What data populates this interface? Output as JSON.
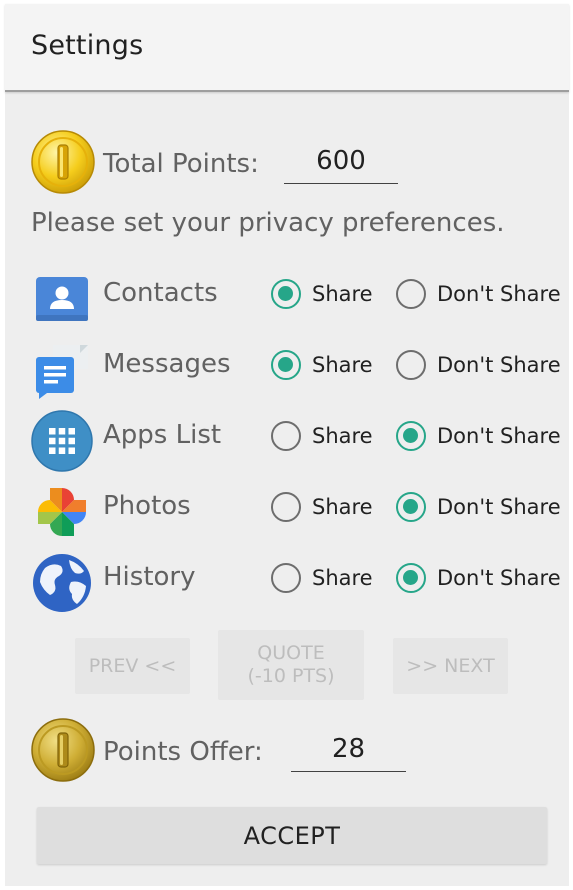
{
  "appbar": {
    "title": "Settings"
  },
  "total_points": {
    "label": "Total Points:",
    "value": "600"
  },
  "prompt": "Please set your privacy preferences.",
  "preferences": [
    {
      "label": "Contacts",
      "icon": "contacts-icon",
      "share_label": "Share",
      "dont_share_label": "Don't Share",
      "selected": "share"
    },
    {
      "label": "Messages",
      "icon": "messages-icon",
      "share_label": "Share",
      "dont_share_label": "Don't Share",
      "selected": "share"
    },
    {
      "label": "Apps List",
      "icon": "apps-list-icon",
      "share_label": "Share",
      "dont_share_label": "Don't Share",
      "selected": "dont_share"
    },
    {
      "label": "Photos",
      "icon": "photos-icon",
      "share_label": "Share",
      "dont_share_label": "Don't Share",
      "selected": "dont_share"
    },
    {
      "label": "History",
      "icon": "history-icon",
      "share_label": "Share",
      "dont_share_label": "Don't Share",
      "selected": "dont_share"
    }
  ],
  "nav": {
    "prev_label": "PREV <<",
    "quote_line1": "QUOTE",
    "quote_line2": "(-10 PTS)",
    "next_label": ">> NEXT"
  },
  "points_offer": {
    "label": "Points Offer:",
    "value": "28"
  },
  "accept_label": "ACCEPT",
  "colors": {
    "accent": "#26a689",
    "coin_gold": "#f2c40f",
    "coin_bronze": "#c9a227"
  }
}
